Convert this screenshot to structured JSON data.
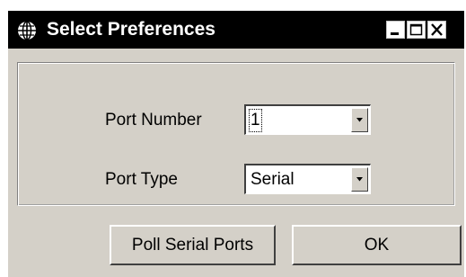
{
  "window": {
    "title": "Select Preferences",
    "title_icon": "globe-icon",
    "controls": [
      "minimize-icon",
      "maximize-icon",
      "close-icon"
    ]
  },
  "form": {
    "port_number_label": "Port Number",
    "port_number_value": "1",
    "port_type_label": "Port Type",
    "port_type_value": "Serial"
  },
  "buttons": {
    "poll_label": "Poll Serial Ports",
    "ok_label": "OK"
  },
  "colors": {
    "titlebar": "#000000",
    "face": "#d4d0c8"
  }
}
